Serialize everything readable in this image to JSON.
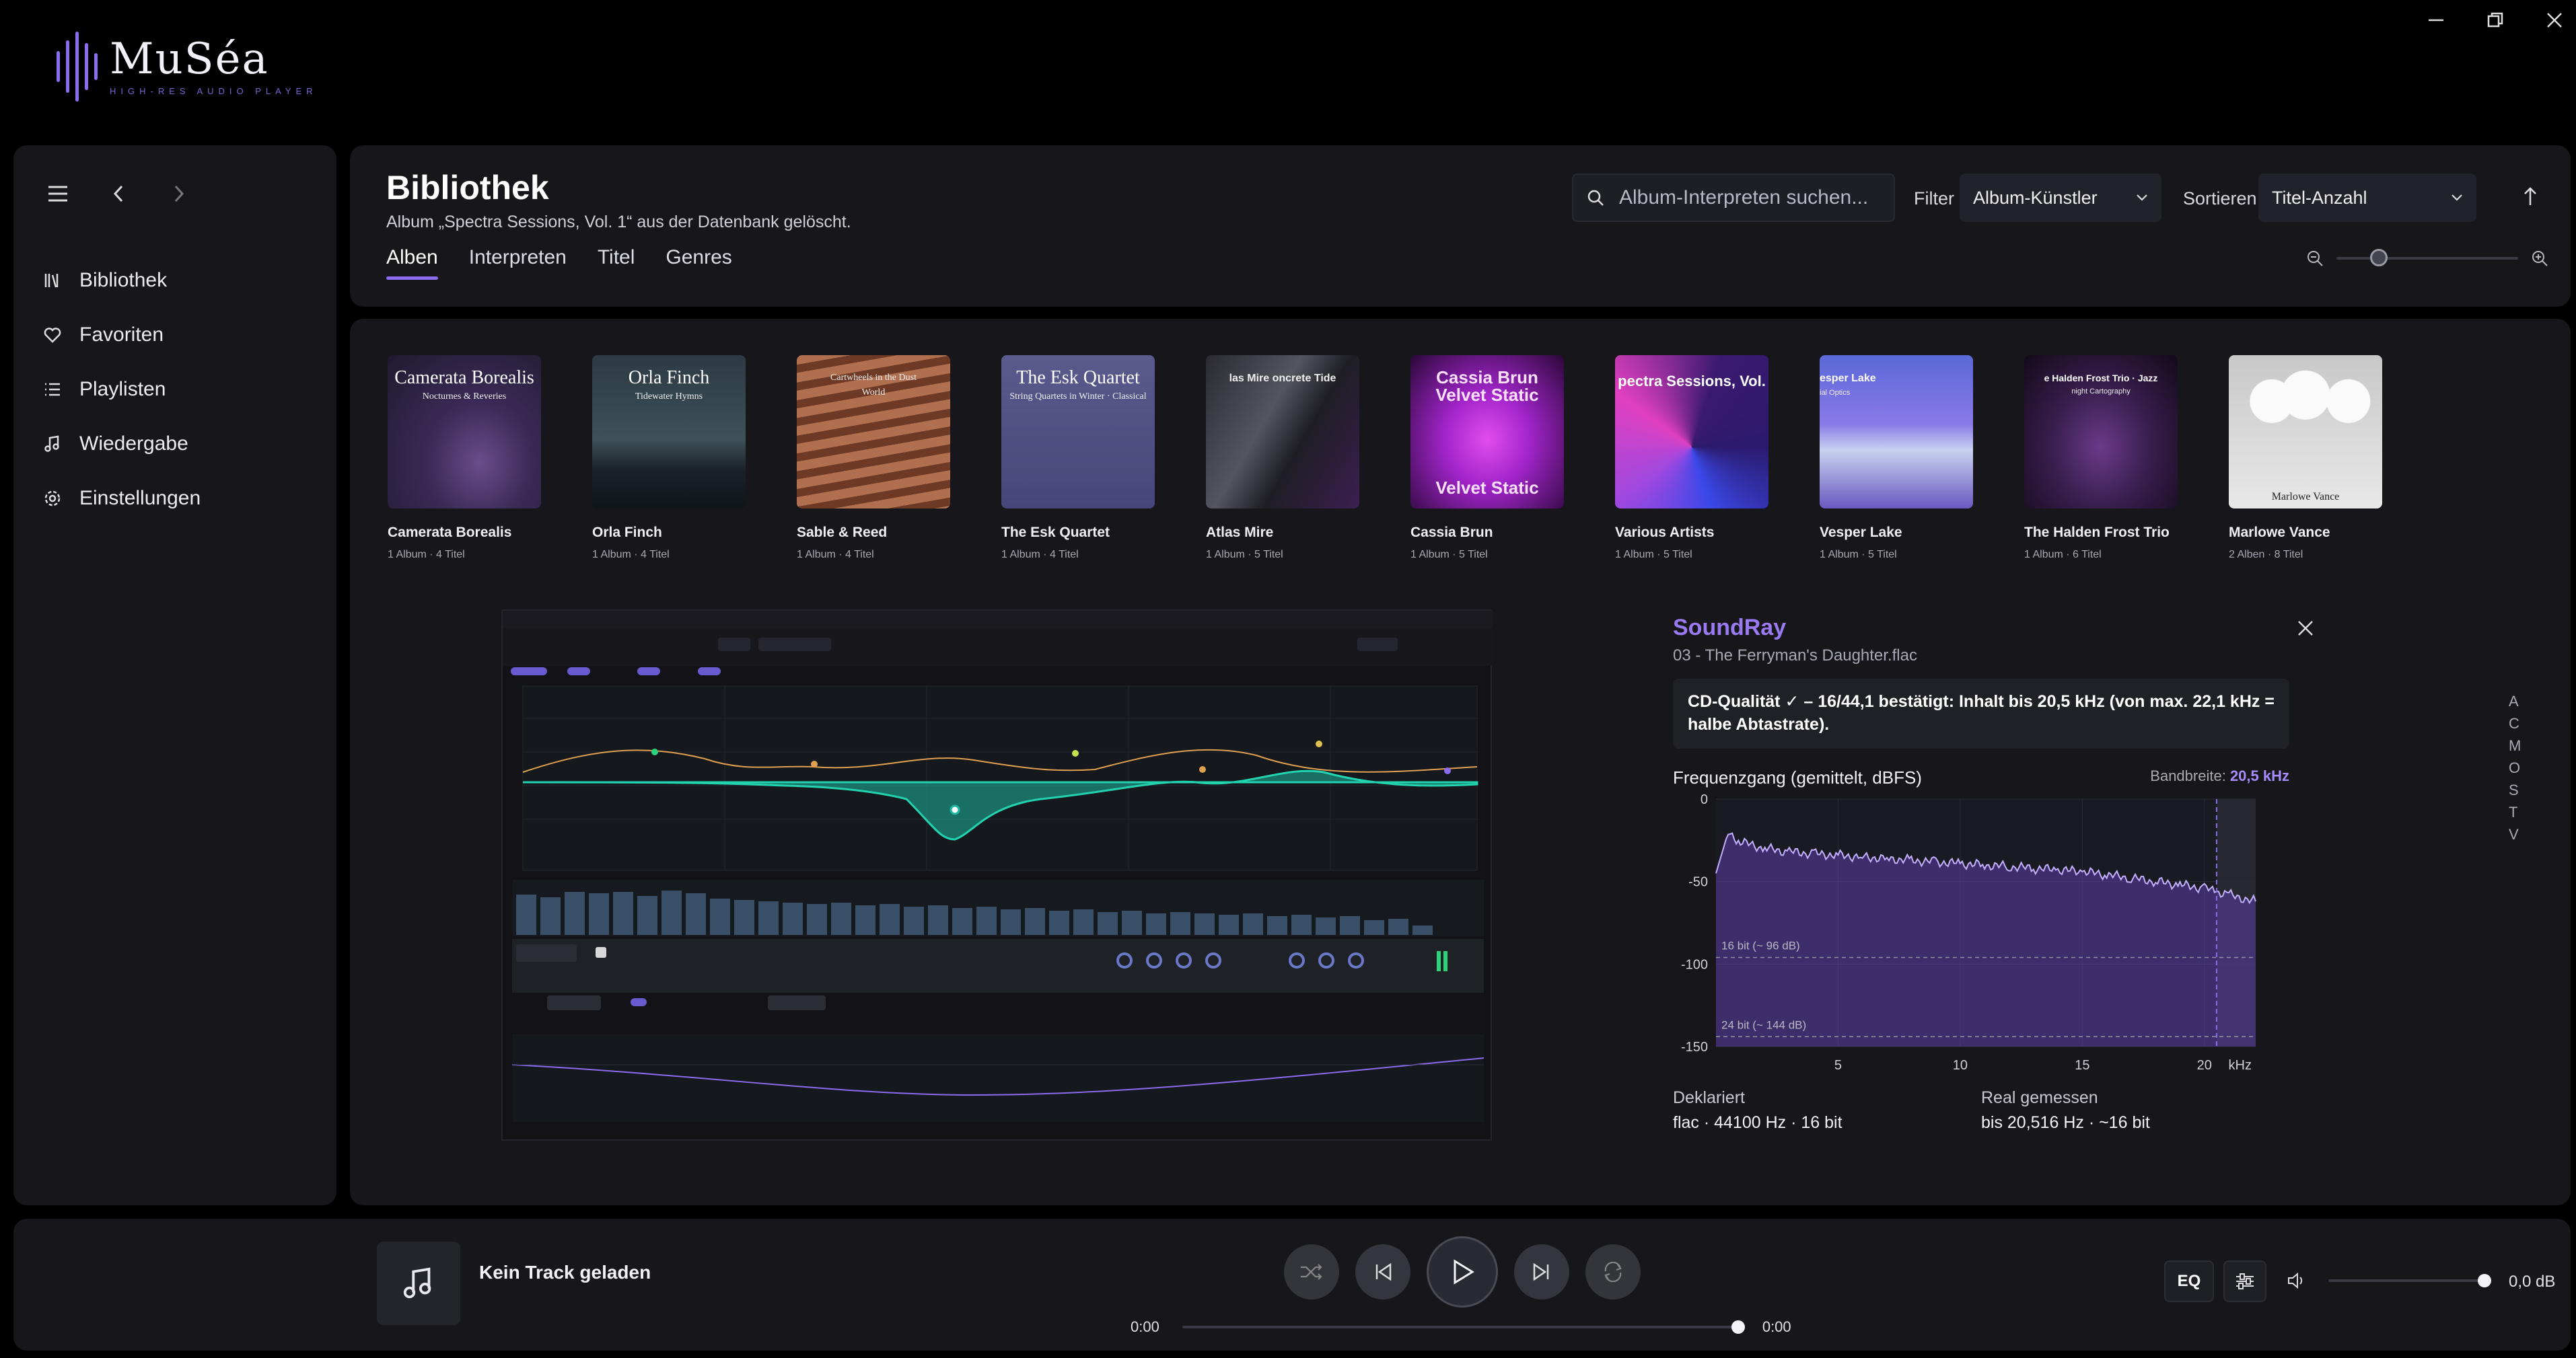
{
  "app": {
    "name": "MuSéa",
    "tagline": "HIGH-RES AUDIO PLAYER"
  },
  "colors": {
    "accent": "#8b6cf0",
    "panel": "#16161b",
    "background": "#000000"
  },
  "sidebar": {
    "items": [
      {
        "label": "Bibliothek",
        "icon": "library-icon"
      },
      {
        "label": "Favoriten",
        "icon": "heart-icon"
      },
      {
        "label": "Playlisten",
        "icon": "list-icon"
      },
      {
        "label": "Wiedergabe",
        "icon": "music-note-icon"
      },
      {
        "label": "Einstellungen",
        "icon": "gear-icon"
      }
    ]
  },
  "header": {
    "title": "Bibliothek",
    "message": "Album „Spectra Sessions, Vol. 1“ aus der Datenbank gelöscht.",
    "tabs": [
      "Alben",
      "Interpreten",
      "Titel",
      "Genres"
    ],
    "active_tab": "Alben",
    "search_placeholder": "Album-Interpreten suchen...",
    "filter_label": "Filter",
    "filter_value": "Album-Künstler",
    "sort_label": "Sortieren",
    "sort_value": "Titel-Anzahl"
  },
  "albums": [
    {
      "name": "Camerata Borealis",
      "meta": "1 Album · 4 Titel",
      "cover_title": "Camerata Borealis",
      "cover_sub": "Nocturnes & Reveries"
    },
    {
      "name": "Orla Finch",
      "meta": "1 Album · 4 Titel",
      "cover_title": "Orla Finch",
      "cover_sub": "Tidewater Hymns"
    },
    {
      "name": "Sable & Reed",
      "meta": "1 Album · 4 Titel",
      "cover_title": "Cartwheels in the Dust",
      "cover_sub": "World"
    },
    {
      "name": "The Esk Quartet",
      "meta": "1 Album · 4 Titel",
      "cover_title": "The Esk Quartet",
      "cover_sub": "String Quartets in Winter · Classical"
    },
    {
      "name": "Atlas Mire",
      "meta": "1 Album · 5 Titel",
      "cover_title": "las Mire oncrete Tide",
      "cover_sub": ""
    },
    {
      "name": "Cassia Brun",
      "meta": "1 Album · 5 Titel",
      "cover_title": "Cassia Brun Velvet Static",
      "cover_sub": "Velvet Static"
    },
    {
      "name": "Various Artists",
      "meta": "1 Album · 5 Titel",
      "cover_title": "pectra Sessions, Vol.",
      "cover_sub": ""
    },
    {
      "name": "Vesper Lake",
      "meta": "1 Album · 5 Titel",
      "cover_title": "esper Lake",
      "cover_sub": "ial Optics"
    },
    {
      "name": "The Halden Frost Trio",
      "meta": "1 Album · 6 Titel",
      "cover_title": "e Halden Frost Trio · Jazz",
      "cover_sub": "night Cartography"
    },
    {
      "name": "Marlowe Vance",
      "meta": "2 Alben · 8 Titel",
      "cover_title": "Marlowe Vance",
      "cover_sub": ""
    }
  ],
  "soundray": {
    "title": "SoundRay",
    "file": "03 - The Ferryman's Daughter.flac",
    "verdict": "CD-Qualität ✓ – 16/44,1 bestätigt: Inhalt bis 20,5 kHz (von max. 22,1 kHz = halbe Abtastrate).",
    "chart_title": "Frequenzgang (gemittelt, dBFS)",
    "bandwidth_label": "Bandbreite:",
    "bandwidth_value": "20,5 kHz",
    "declared_label": "Deklariert",
    "declared_value": "flac · 44100 Hz · 16 bit",
    "measured_label": "Real gemessen",
    "measured_value": "bis 20,516 Hz · ~16 bit"
  },
  "chart_data": {
    "type": "area",
    "title": "Frequenzgang (gemittelt, dBFS)",
    "xlabel": "kHz",
    "ylabel": "",
    "xlim": [
      0,
      22.1
    ],
    "ylim": [
      -150,
      0
    ],
    "x_ticks": [
      5,
      10,
      15,
      20
    ],
    "y_ticks": [
      0,
      -50,
      -100,
      -150
    ],
    "x": [
      0,
      0.5,
      1,
      2,
      3,
      4,
      5,
      6,
      7,
      8,
      9,
      10,
      11,
      12,
      13,
      14,
      15,
      16,
      17,
      18,
      19,
      20,
      20.5,
      21,
      22.1
    ],
    "values": [
      -45,
      -20,
      -26,
      -30,
      -32,
      -33,
      -34,
      -35,
      -36,
      -37,
      -38,
      -39,
      -40,
      -41,
      -42,
      -43,
      -44,
      -46,
      -48,
      -50,
      -52,
      -54,
      -56,
      -58,
      -62
    ],
    "reference_lines": [
      {
        "label": "16 bit (~ 96 dB)",
        "y": -96
      },
      {
        "label": "24 bit (~ 144 dB)",
        "y": -144
      }
    ],
    "cutoff_khz": 20.5,
    "grid": true
  },
  "alpha_index": [
    "A",
    "C",
    "M",
    "O",
    "S",
    "T",
    "V"
  ],
  "player": {
    "track": "Kein Track geladen",
    "time_current": "0:00",
    "time_total": "0:00",
    "eq_label": "EQ",
    "volume_db": "0,0 dB",
    "volume_level": 1.0
  }
}
